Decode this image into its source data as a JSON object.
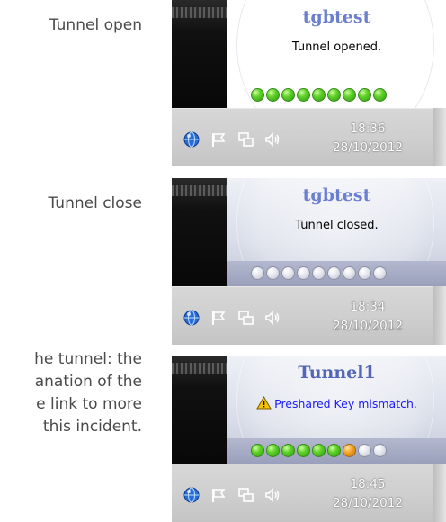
{
  "captions": [
    "Tunnel open",
    "Tunnel close",
    "he tunnel: the",
    "anation of the",
    "e link to more",
    "this incident."
  ],
  "notifications": [
    {
      "title": "tgbtest",
      "message": "Tunnel opened.",
      "dots": [
        "green",
        "green",
        "green",
        "green",
        "green",
        "green",
        "green",
        "green",
        "green"
      ],
      "time": "18:36",
      "date": "28/10/2012"
    },
    {
      "title": "tgbtest",
      "message": "Tunnel closed.",
      "dots": [
        "grey",
        "grey",
        "grey",
        "grey",
        "grey",
        "grey",
        "grey",
        "grey",
        "grey"
      ],
      "time": "18:34",
      "date": "28/10/2012"
    },
    {
      "title": "Tunnel1",
      "message": "Preshared Key mismatch.",
      "dots": [
        "green",
        "green",
        "green",
        "green",
        "green",
        "green",
        "orange",
        "grey",
        "grey"
      ],
      "time": "18:45",
      "date": "28/10/2012"
    }
  ],
  "tray_icons": [
    "vpn-globe-icon",
    "flag-icon",
    "network-icon",
    "speaker-icon"
  ],
  "colors": {
    "title_blue": "#6b7fd0",
    "warn_text": "#1a1aff",
    "dot_green": "#5fd12a",
    "dot_orange": "#f0a020",
    "dot_grey": "#e2e4ec"
  }
}
